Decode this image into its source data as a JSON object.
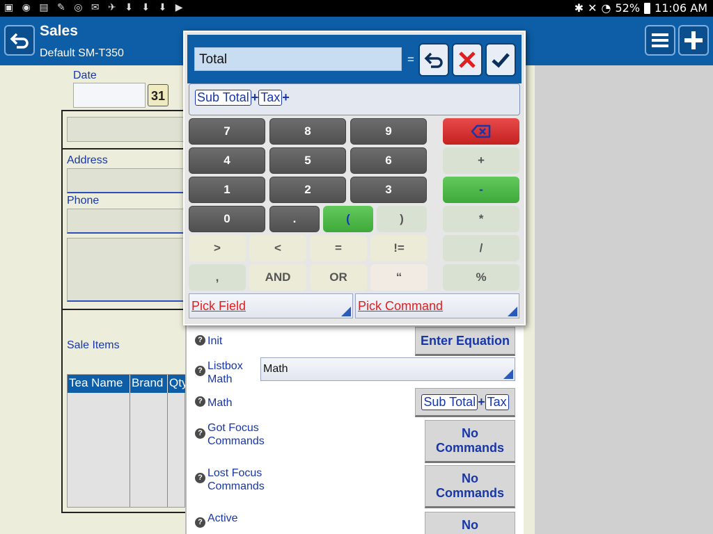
{
  "status": {
    "battery": "52%",
    "time": "11:06 AM"
  },
  "app": {
    "title": "Sales",
    "subtitle": "Default SM-T350"
  },
  "form": {
    "date_label": "Date",
    "calendar_day": "31",
    "address_label": "Address",
    "phone_label": "Phone",
    "sale_items_label": "Sale Items",
    "table_columns": [
      "Tea Name",
      "Brand",
      "Qty"
    ]
  },
  "calculator": {
    "field_value": "Total",
    "equals": "=",
    "expression": {
      "token1": "Sub Total",
      "op1": "+",
      "token2": "Tax",
      "op2": "+"
    },
    "keys": {
      "k7": "7",
      "k8": "8",
      "k9": "9",
      "k4": "4",
      "k5": "5",
      "k6": "6",
      "k1": "1",
      "k2": "2",
      "k3": "3",
      "k0": "0",
      "kdot": ".",
      "kopen": "(",
      "kclose": ")",
      "kgt": ">",
      "klt": "<",
      "keq": "=",
      "kneq": "!=",
      "kcomma": ",",
      "kand": "AND",
      "kor": "OR",
      "kquote": "“",
      "kplus": "+",
      "kminus": "-",
      "kmul": "*",
      "kdiv": "/",
      "kpct": "%"
    },
    "pick_field": "Pick Field",
    "pick_command": "Pick Command"
  },
  "properties": {
    "init_label": "Init",
    "enter_equation": "Enter Equation",
    "listbox_label_1": "Listbox",
    "listbox_label_2": "Math",
    "listbox_value": "Math",
    "math_label": "Math",
    "math_token1": "Sub Total",
    "math_op": "+",
    "math_token2": "Tax",
    "got_focus_1": "Got Focus",
    "got_focus_2": "Commands",
    "lost_focus_1": "Lost Focus",
    "lost_focus_2": "Commands",
    "active_label": "Active",
    "no_commands_1": "No",
    "no_commands_2": "Commands",
    "partial_btn": "No"
  },
  "colors": {
    "app_bar": "#0d5ea6",
    "link_blue": "#1736a8",
    "accent_green": "#3ea93a",
    "danger_red": "#c52121"
  }
}
